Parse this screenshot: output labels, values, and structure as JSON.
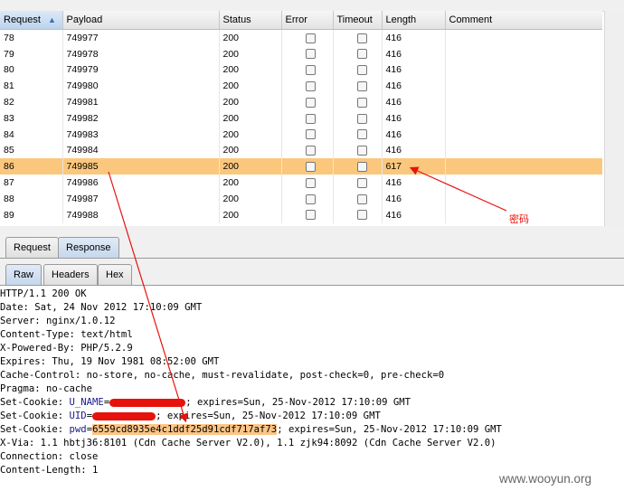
{
  "table": {
    "columns": [
      "Request",
      "Payload",
      "Status",
      "Error",
      "Timeout",
      "Length",
      "Comment"
    ],
    "sorted_column": "Request",
    "rows": [
      {
        "request": "78",
        "payload": "749977",
        "status": "200",
        "length": "416",
        "selected": false
      },
      {
        "request": "79",
        "payload": "749978",
        "status": "200",
        "length": "416",
        "selected": false
      },
      {
        "request": "80",
        "payload": "749979",
        "status": "200",
        "length": "416",
        "selected": false
      },
      {
        "request": "81",
        "payload": "749980",
        "status": "200",
        "length": "416",
        "selected": false
      },
      {
        "request": "82",
        "payload": "749981",
        "status": "200",
        "length": "416",
        "selected": false
      },
      {
        "request": "83",
        "payload": "749982",
        "status": "200",
        "length": "416",
        "selected": false
      },
      {
        "request": "84",
        "payload": "749983",
        "status": "200",
        "length": "416",
        "selected": false
      },
      {
        "request": "85",
        "payload": "749984",
        "status": "200",
        "length": "416",
        "selected": false
      },
      {
        "request": "86",
        "payload": "749985",
        "status": "200",
        "length": "617",
        "selected": true
      },
      {
        "request": "87",
        "payload": "749986",
        "status": "200",
        "length": "416",
        "selected": false
      },
      {
        "request": "88",
        "payload": "749987",
        "status": "200",
        "length": "416",
        "selected": false
      },
      {
        "request": "89",
        "payload": "749988",
        "status": "200",
        "length": "416",
        "selected": false
      }
    ]
  },
  "tabs": {
    "outer": [
      "Request",
      "Response"
    ],
    "outer_active": "Response",
    "inner": [
      "Raw",
      "Headers",
      "Hex"
    ],
    "inner_active": "Raw"
  },
  "response": {
    "line1": "HTTP/1.1 200 OK",
    "line2": "Date: Sat, 24 Nov 2012 17:10:09 GMT",
    "line3": "Server: nginx/1.0.12",
    "line4": "Content-Type: text/html",
    "line5": "X-Powered-By: PHP/5.2.9",
    "line6": "Expires: Thu, 19 Nov 1981 08:52:00 GMT",
    "line7": "Cache-Control: no-store, no-cache, must-revalidate, post-check=0, pre-check=0",
    "line8": "Pragma: no-cache",
    "cookie1_prefix": "Set-Cookie: ",
    "cookie1_key": "U_NAME",
    "cookie1_suffix": "; expires=Sun, 25-Nov-2012 17:10:09 GMT",
    "cookie2_prefix": "Set-Cookie: ",
    "cookie2_key": "UID",
    "cookie2_suffix": "; expires=Sun, 25-Nov-2012 17:10:09 GMT",
    "cookie3_prefix": "Set-Cookie: ",
    "cookie3_key": "pwd",
    "cookie3_value": "6559cd8935e4c1ddf25d91cdf717af73",
    "cookie3_suffix": "; expires=Sun, 25-Nov-2012 17:10:09 GMT",
    "line12": "X-Via: 1.1 hbtj36:8101 (Cdn Cache Server V2.0), 1.1 zjk94:8092 (Cdn Cache Server V2.0)",
    "line13": "Connection: close",
    "line14": "Content-Length: 1"
  },
  "annotation": {
    "label": "密码",
    "color": "#e8120c"
  },
  "watermark": "www.wooyun.org",
  "colors": {
    "selected_row": "#fbc77d",
    "highlight": "#fcc587",
    "redaction": "#e8120c"
  }
}
